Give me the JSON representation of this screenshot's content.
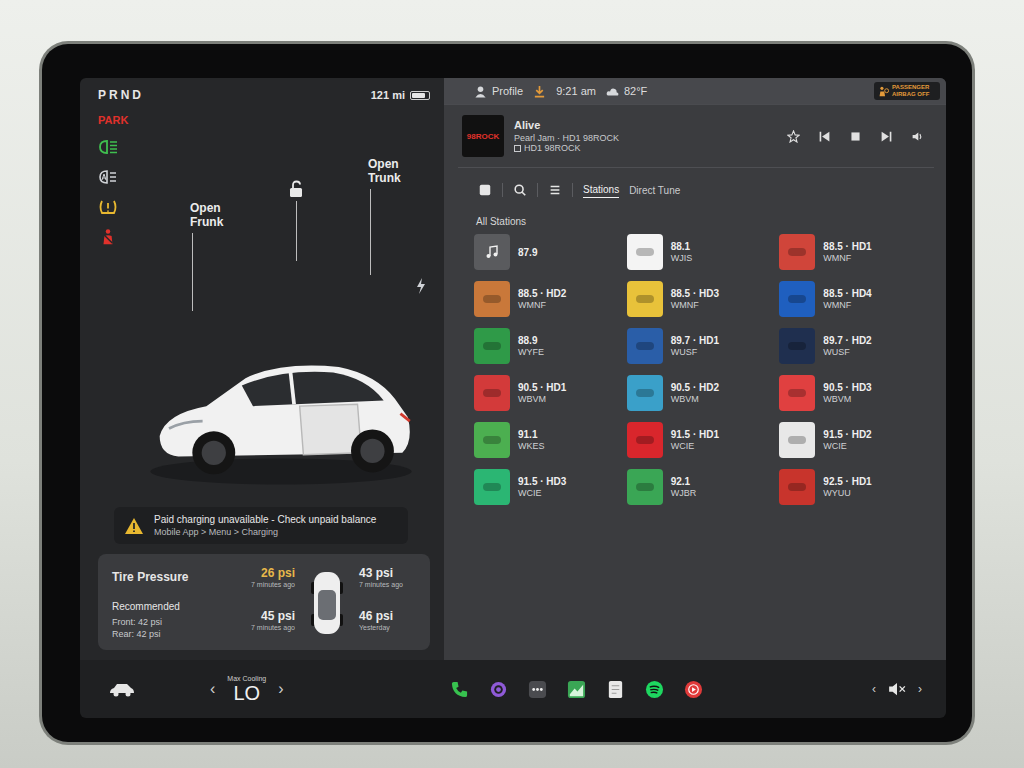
{
  "left": {
    "gear": "PRND",
    "park": "PARK",
    "range": "121 mi",
    "battery": 0.8,
    "indicators": [
      {
        "color": "#3fbf4f"
      },
      {
        "color": "#cfd2d6"
      },
      {
        "color": "#e8b830"
      },
      {
        "color": "#e0312b"
      }
    ],
    "frunk": "Open Frunk",
    "trunk": "Open Trunk",
    "warning": {
      "title": "Paid charging unavailable - Check unpaid balance",
      "hint": "Mobile App > Menu > Charging"
    },
    "tires": {
      "title": "Tire Pressure",
      "recommended": "Recommended",
      "front": "Front: 42 psi",
      "rear": "Rear: 42 psi",
      "readings": [
        {
          "psi": "26 psi",
          "time": "7 minutes ago",
          "low": true
        },
        {
          "psi": "43 psi",
          "time": "7 minutes ago",
          "low": false
        },
        {
          "psi": "45 psi",
          "time": "7 minutes ago",
          "low": false
        },
        {
          "psi": "46 psi",
          "time": "Yesterday",
          "low": false
        }
      ]
    }
  },
  "status": {
    "profile": "Profile",
    "time": "9:21 am",
    "temp": "82°F",
    "airbag": "PASSENGER AIRBAG OFF"
  },
  "nowPlaying": {
    "logo": "98ROCK",
    "title": "Alive",
    "subtitle": "Pearl Jam · HD1 98ROCK",
    "source": "HD1 98ROCK"
  },
  "tabs": [
    {
      "label": "Stations",
      "selected": true
    },
    {
      "label": "Direct Tune",
      "selected": false
    }
  ],
  "sectionTitle": "All Stations",
  "stations": [
    {
      "freq": "87.9",
      "kind": "generic",
      "color": "#5a5b5e"
    },
    {
      "freq": "88.1",
      "call": "WJIS",
      "kind": "logo",
      "color": "#f4f4f4"
    },
    {
      "freq": "88.5 · HD1",
      "call": "WMNF",
      "kind": "logo",
      "color": "#d0453a"
    },
    {
      "freq": "88.5 · HD2",
      "call": "WMNF",
      "kind": "logo",
      "color": "#c9783a"
    },
    {
      "freq": "88.5 · HD3",
      "call": "WMNF",
      "kind": "logo",
      "color": "#e8c23a"
    },
    {
      "freq": "88.5 · HD4",
      "call": "WMNF",
      "kind": "logo",
      "color": "#1f5fbf"
    },
    {
      "freq": "88.9",
      "call": "WYFE",
      "kind": "logo",
      "color": "#2f9a48"
    },
    {
      "freq": "89.7 · HD1",
      "call": "WUSF",
      "kind": "logo",
      "color": "#2a5ea8"
    },
    {
      "freq": "89.7 · HD2",
      "call": "WUSF",
      "kind": "logo",
      "color": "#1f2f4f"
    },
    {
      "freq": "90.5 · HD1",
      "call": "WBVM",
      "kind": "logo",
      "color": "#d33a3a"
    },
    {
      "freq": "90.5 · HD2",
      "call": "WBVM",
      "kind": "logo",
      "color": "#3aa0c9"
    },
    {
      "freq": "90.5 · HD3",
      "call": "WBVM",
      "kind": "logo",
      "color": "#e04040"
    },
    {
      "freq": "91.1",
      "call": "WKES",
      "kind": "logo",
      "color": "#4caf50"
    },
    {
      "freq": "91.5 · HD1",
      "call": "WCIE",
      "kind": "logo",
      "color": "#d9262c"
    },
    {
      "freq": "91.5 · HD2",
      "call": "WCIE",
      "kind": "logo",
      "color": "#e8e8e8"
    },
    {
      "freq": "91.5 · HD3",
      "call": "WCIE",
      "kind": "logo",
      "color": "#2bb673"
    },
    {
      "freq": "92.1",
      "call": "WJBR",
      "kind": "logo",
      "color": "#3aa655"
    },
    {
      "freq": "92.5 · HD1",
      "call": "WYUU",
      "kind": "logo",
      "color": "#c8342c"
    }
  ],
  "climate": {
    "mode": "Max Cooling",
    "temp": "LO",
    "down": "‹",
    "up": "›"
  },
  "dock": [
    {
      "color": "#37c24f"
    },
    {
      "color": "#8f5ad8"
    },
    {
      "color": "#4a4b4f"
    },
    {
      "color": "#3aa655"
    },
    {
      "color": "#e8e8e8"
    },
    {
      "color": "#1ed760"
    },
    {
      "color": "#e03a3a"
    }
  ],
  "volume": {
    "down": "‹",
    "up": "›",
    "muted": true
  }
}
